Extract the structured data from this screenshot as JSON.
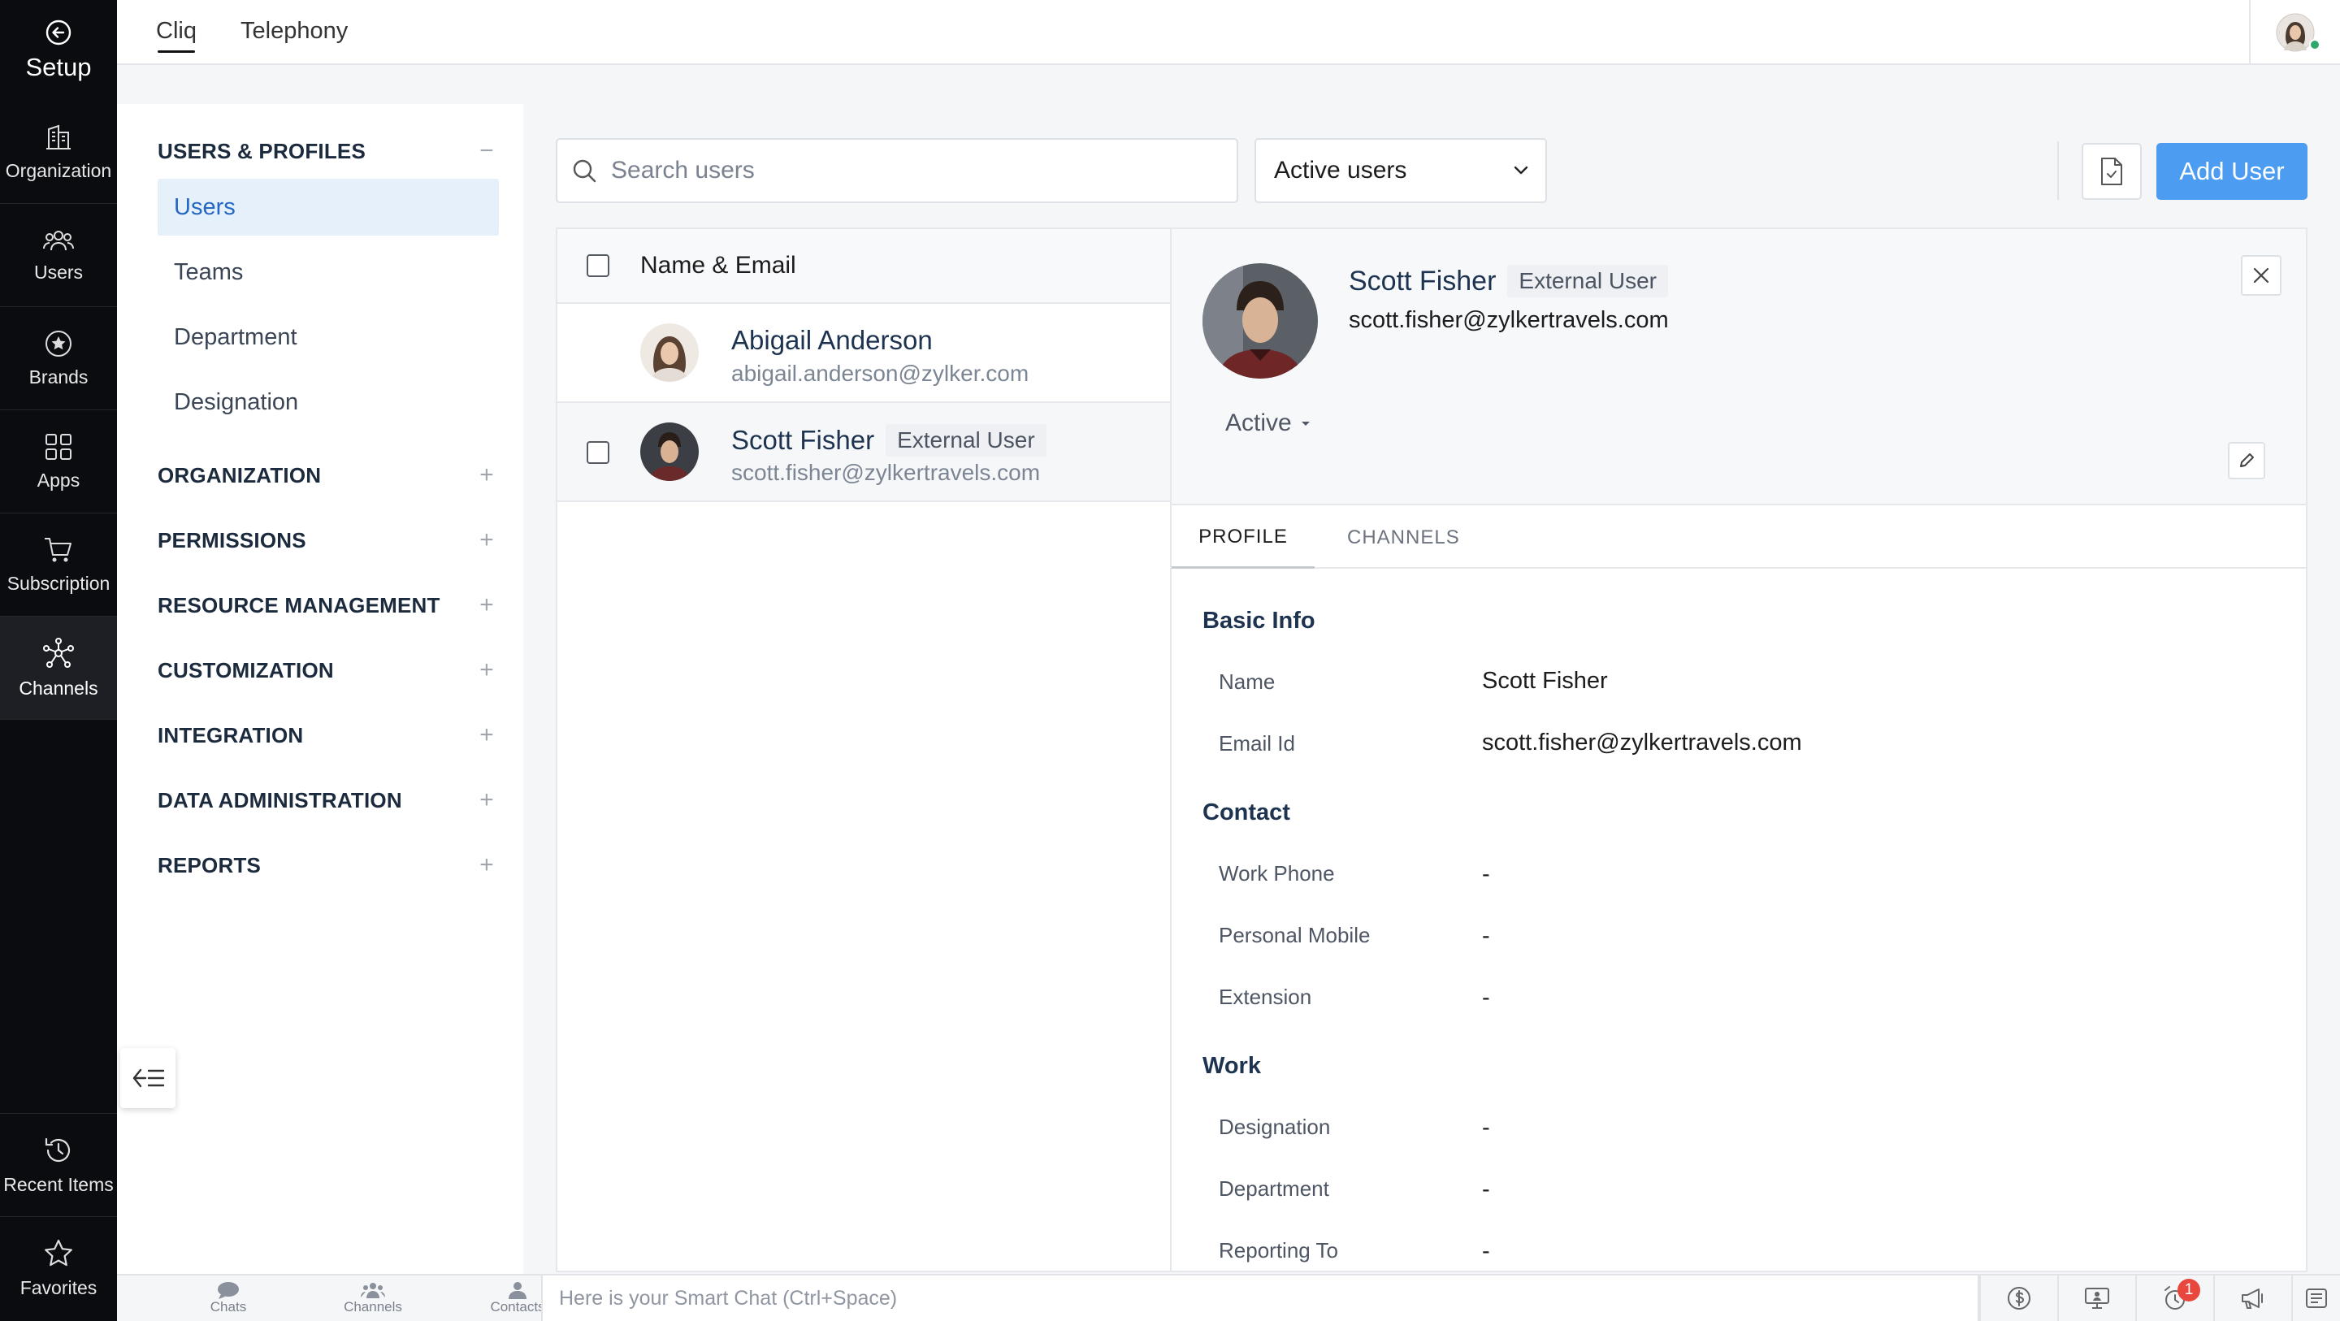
{
  "rail": {
    "title": "Setup",
    "items": [
      {
        "label": "Organization",
        "icon": "building-icon"
      },
      {
        "label": "Users",
        "icon": "users-icon"
      },
      {
        "label": "Brands",
        "icon": "star-badge-icon"
      },
      {
        "label": "Apps",
        "icon": "apps-grid-icon"
      },
      {
        "label": "Subscription",
        "icon": "cart-icon"
      },
      {
        "label": "Channels",
        "icon": "network-icon"
      }
    ],
    "bottom": [
      {
        "label": "Recent Items",
        "icon": "history-icon"
      },
      {
        "label": "Favorites",
        "icon": "star-icon"
      }
    ]
  },
  "topbar": {
    "tabs": [
      "Cliq",
      "Telephony"
    ]
  },
  "nav": {
    "users_profiles": {
      "label": "USERS & PROFILES",
      "items": [
        "Users",
        "Teams",
        "Department",
        "Designation"
      ]
    },
    "sections": [
      "ORGANIZATION",
      "PERMISSIONS",
      "RESOURCE MANAGEMENT",
      "CUSTOMIZATION",
      "INTEGRATION",
      "DATA ADMINISTRATION",
      "REPORTS"
    ]
  },
  "toolbar": {
    "search_placeholder": "Search users",
    "filter": "Active users",
    "add_user": "Add User"
  },
  "list": {
    "header": "Name & Email",
    "users": [
      {
        "name": "Abigail Anderson",
        "email": "abigail.anderson@zylker.com",
        "badge": ""
      },
      {
        "name": "Scott Fisher",
        "email": "scott.fisher@zylkertravels.com",
        "badge": "External User"
      }
    ]
  },
  "detail": {
    "name": "Scott Fisher",
    "badge": "External User",
    "email": "scott.fisher@zylkertravels.com",
    "status": "Active",
    "tabs": [
      "PROFILE",
      "CHANNELS"
    ],
    "groups": {
      "basic": {
        "title": "Basic Info",
        "fields": [
          {
            "label": "Name",
            "value": "Scott Fisher"
          },
          {
            "label": "Email Id",
            "value": "scott.fisher@zylkertravels.com"
          }
        ]
      },
      "contact": {
        "title": "Contact",
        "fields": [
          {
            "label": "Work Phone",
            "value": "-"
          },
          {
            "label": "Personal Mobile",
            "value": "-"
          },
          {
            "label": "Extension",
            "value": "-"
          }
        ]
      },
      "work": {
        "title": "Work",
        "fields": [
          {
            "label": "Designation",
            "value": "-"
          },
          {
            "label": "Department",
            "value": "-"
          },
          {
            "label": "Reporting To",
            "value": "-"
          }
        ]
      }
    }
  },
  "bottombar": {
    "tabs": [
      "Chats",
      "Channels",
      "Contacts"
    ],
    "smart_chat": "Here is your Smart Chat (Ctrl+Space)",
    "notification_count": "1"
  }
}
